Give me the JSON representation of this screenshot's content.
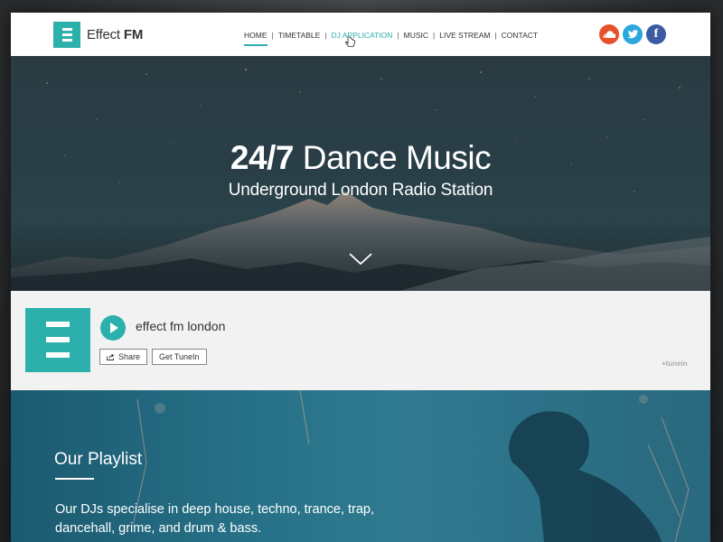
{
  "brand": {
    "name_light": "Effect",
    "name_bold": "FM",
    "accent": "#2bb0ab"
  },
  "nav": {
    "items": [
      {
        "label": "HOME",
        "state": "active"
      },
      {
        "label": "TIMETABLE",
        "state": "normal"
      },
      {
        "label": "DJ APPLICATION",
        "state": "hover"
      },
      {
        "label": "MUSIC",
        "state": "normal"
      },
      {
        "label": "LIVE STREAM",
        "state": "normal"
      },
      {
        "label": "CONTACT",
        "state": "normal"
      }
    ],
    "separator": "|"
  },
  "socials": [
    {
      "icon": "soundcloud-icon",
      "color": "#e5512b"
    },
    {
      "icon": "twitter-icon",
      "color": "#2aa7dd"
    },
    {
      "icon": "facebook-icon",
      "color": "#3b5ba3",
      "glyph": "f"
    }
  ],
  "hero": {
    "title_bold": "24/7",
    "title_rest": " Dance Music",
    "subtitle": "Underground London Radio Station",
    "scroll_icon": "chevron-down-icon"
  },
  "player": {
    "station_name": "effect fm london",
    "share_label": "Share",
    "get_tunein_label": "Get TuneIn",
    "provider_logo": "+tunein"
  },
  "playlist": {
    "title": "Our Playlist",
    "description": "Our DJs specialise in deep house, techno, trance, trap, dancehall, grime, and drum & bass."
  }
}
